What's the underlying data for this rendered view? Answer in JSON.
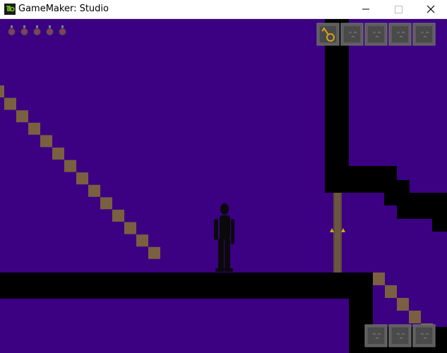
{
  "window": {
    "title": "GameMaker: Studio",
    "icon": "gamemaker-logo-icon",
    "controls": [
      "minimize-icon",
      "maximize-icon",
      "close-icon"
    ]
  },
  "game": {
    "colors": {
      "background": "#3c0083",
      "wall": "#000000",
      "stair": "#7a6040",
      "slot": "#5a5a5a",
      "door": "#5c4a3a"
    },
    "lives": 5,
    "inventory_top_slots": 5,
    "inventory_top_filled": 1,
    "inventory_bottom_slots": 3
  }
}
